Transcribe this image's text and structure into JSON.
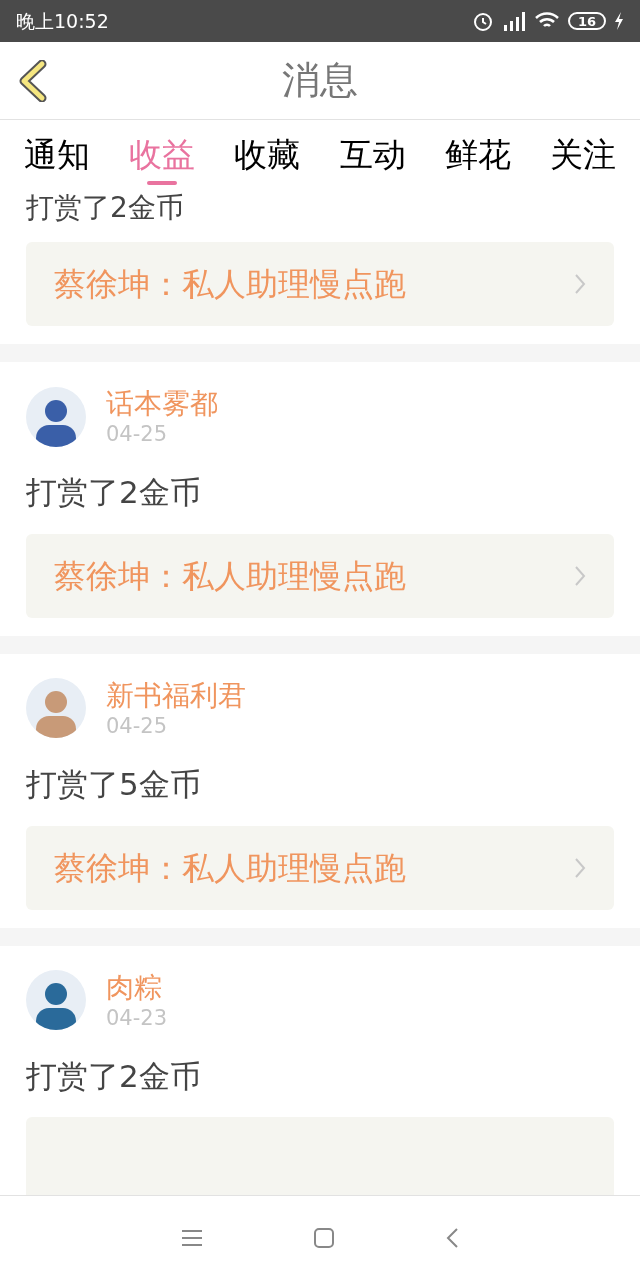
{
  "status_bar": {
    "time": "晚上10:52",
    "battery": "16"
  },
  "header": {
    "title": "消息"
  },
  "tabs": [
    {
      "label": "通知",
      "selected": false
    },
    {
      "label": "收益",
      "selected": true
    },
    {
      "label": "收藏",
      "selected": false
    },
    {
      "label": "互动",
      "selected": false
    },
    {
      "label": "鲜花",
      "selected": false
    },
    {
      "label": "关注",
      "selected": false
    }
  ],
  "feed": [
    {
      "kind": "top",
      "message": "打赏了2金币",
      "link": "蔡徐坤：私人助理慢点跑"
    },
    {
      "kind": "full",
      "name": "话本雾都",
      "date": "04-25",
      "message": "打赏了2金币",
      "link": "蔡徐坤：私人助理慢点跑",
      "color": "#3a5fa8"
    },
    {
      "kind": "full",
      "name": "新书福利君",
      "date": "04-25",
      "message": "打赏了5金币",
      "link": "蔡徐坤：私人助理慢点跑",
      "color": "#c89a78"
    },
    {
      "kind": "bottom",
      "name": "肉粽",
      "date": "04-23",
      "message": "打赏了2金币",
      "color": "#2a6a9a"
    }
  ]
}
